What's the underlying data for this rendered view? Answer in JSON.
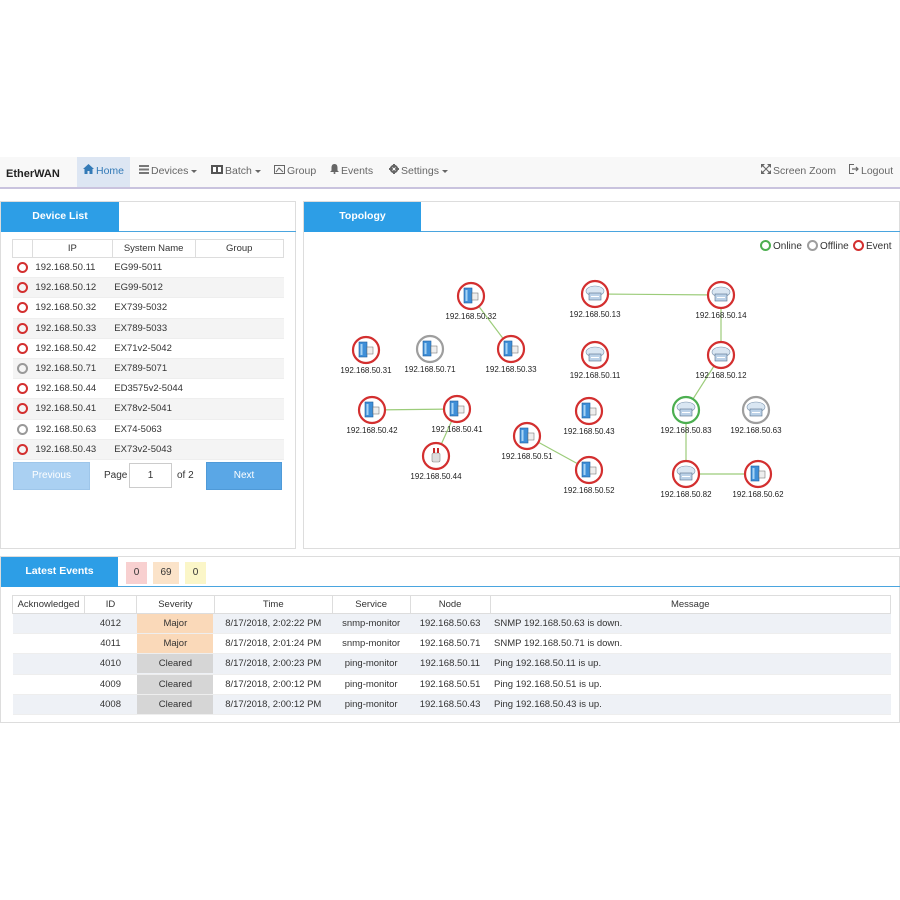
{
  "nav": {
    "brand": "EtherWAN",
    "items": [
      {
        "label": "Home",
        "icon": "home-icon"
      },
      {
        "label": "Devices",
        "icon": "list-icon"
      },
      {
        "label": "Batch",
        "icon": "batch-icon"
      },
      {
        "label": "Group",
        "icon": "group-icon"
      },
      {
        "label": "Events",
        "icon": "bell-icon"
      },
      {
        "label": "Settings",
        "icon": "gear-icon"
      }
    ],
    "right": [
      {
        "label": "Screen Zoom",
        "icon": "expand-icon"
      },
      {
        "label": "Logout",
        "icon": "logout-icon"
      }
    ]
  },
  "device_list": {
    "title": "Device List",
    "columns": [
      "IP",
      "System Name",
      "Group"
    ],
    "rows": [
      {
        "ip": "192.168.50.11",
        "name": "EG99-5011",
        "group": "",
        "status": "event"
      },
      {
        "ip": "192.168.50.12",
        "name": "EG99-5012",
        "group": "",
        "status": "event"
      },
      {
        "ip": "192.168.50.32",
        "name": "EX739-5032",
        "group": "",
        "status": "event"
      },
      {
        "ip": "192.168.50.33",
        "name": "EX789-5033",
        "group": "",
        "status": "event"
      },
      {
        "ip": "192.168.50.42",
        "name": "EX71v2-5042",
        "group": "",
        "status": "event"
      },
      {
        "ip": "192.168.50.71",
        "name": "EX789-5071",
        "group": "",
        "status": "offline"
      },
      {
        "ip": "192.168.50.44",
        "name": "ED3575v2-5044",
        "group": "",
        "status": "event"
      },
      {
        "ip": "192.168.50.41",
        "name": "EX78v2-5041",
        "group": "",
        "status": "event"
      },
      {
        "ip": "192.168.50.63",
        "name": "EX74-5063",
        "group": "",
        "status": "offline"
      },
      {
        "ip": "192.168.50.43",
        "name": "EX73v2-5043",
        "group": "",
        "status": "event"
      }
    ],
    "pager": {
      "previous": "Previous",
      "page_label": "Page",
      "page": "1",
      "of": "of 2",
      "next": "Next"
    }
  },
  "topology": {
    "title": "Topology",
    "legend": [
      {
        "label": "Online",
        "color": "#4caf50"
      },
      {
        "label": "Offline",
        "color": "#9e9e9e"
      },
      {
        "label": "Event",
        "color": "#d32f2f"
      }
    ],
    "nodes": [
      {
        "id": "192.168.50.32",
        "status": "event",
        "kind": "box",
        "badge": "L3"
      },
      {
        "id": "192.168.50.13",
        "status": "event",
        "kind": "cloud",
        "badge": "L2"
      },
      {
        "id": "192.168.50.14",
        "status": "event",
        "kind": "cloud",
        "badge": "L2"
      },
      {
        "id": "192.168.50.31",
        "status": "event",
        "kind": "box",
        "badge": "L2"
      },
      {
        "id": "192.168.50.71",
        "status": "offline",
        "kind": "box",
        "badge": "L3"
      },
      {
        "id": "192.168.50.33",
        "status": "event",
        "kind": "box",
        "badge": "L3"
      },
      {
        "id": "192.168.50.11",
        "status": "event",
        "kind": "cloud",
        "badge": "L2"
      },
      {
        "id": "192.168.50.12",
        "status": "event",
        "kind": "cloud",
        "badge": "L2"
      },
      {
        "id": "192.168.50.42",
        "status": "event",
        "kind": "box",
        "badge": "L2"
      },
      {
        "id": "192.168.50.41",
        "status": "event",
        "kind": "box",
        "badge": "L2"
      },
      {
        "id": "192.168.50.43",
        "status": "event",
        "kind": "box",
        "badge": "L2"
      },
      {
        "id": "192.168.50.83",
        "status": "online",
        "kind": "cloud",
        "badge": "L2"
      },
      {
        "id": "192.168.50.63",
        "status": "offline",
        "kind": "cloud",
        "badge": "L2"
      },
      {
        "id": "192.168.50.51",
        "status": "event",
        "kind": "box",
        "badge": "L2"
      },
      {
        "id": "192.168.50.44",
        "status": "event",
        "kind": "plug",
        "badge": ""
      },
      {
        "id": "192.168.50.52",
        "status": "event",
        "kind": "box",
        "badge": "L2"
      },
      {
        "id": "192.168.50.82",
        "status": "event",
        "kind": "cloud",
        "badge": "L2"
      },
      {
        "id": "192.168.50.62",
        "status": "event",
        "kind": "box",
        "badge": "L2"
      }
    ],
    "links": [
      [
        "192.168.50.32",
        "192.168.50.33"
      ],
      [
        "192.168.50.13",
        "192.168.50.14"
      ],
      [
        "192.168.50.14",
        "192.168.50.12"
      ],
      [
        "192.168.50.12",
        "192.168.50.83"
      ],
      [
        "192.168.50.42",
        "192.168.50.41"
      ],
      [
        "192.168.50.41",
        "192.168.50.44"
      ],
      [
        "192.168.50.51",
        "192.168.50.52"
      ],
      [
        "192.168.50.83",
        "192.168.50.82"
      ],
      [
        "192.168.50.82",
        "192.168.50.62"
      ]
    ]
  },
  "events": {
    "title": "Latest Events",
    "badges": [
      {
        "value": "0",
        "color": "#f8d0d0"
      },
      {
        "value": "69",
        "color": "#fbe3c9"
      },
      {
        "value": "0",
        "color": "#fbf6c8"
      }
    ],
    "columns": [
      "Acknowledged",
      "ID",
      "Severity",
      "Time",
      "Service",
      "Node",
      "Message"
    ],
    "rows": [
      {
        "ack": "",
        "id": "4012",
        "severity": "Major",
        "time": "8/17/2018, 2:02:22 PM",
        "service": "snmp-monitor",
        "node": "192.168.50.63",
        "message": "SNMP 192.168.50.63 is down."
      },
      {
        "ack": "",
        "id": "4011",
        "severity": "Major",
        "time": "8/17/2018, 2:01:24 PM",
        "service": "snmp-monitor",
        "node": "192.168.50.71",
        "message": "SNMP 192.168.50.71 is down."
      },
      {
        "ack": "",
        "id": "4010",
        "severity": "Cleared",
        "time": "8/17/2018, 2:00:23 PM",
        "service": "ping-monitor",
        "node": "192.168.50.11",
        "message": "Ping 192.168.50.11 is up."
      },
      {
        "ack": "",
        "id": "4009",
        "severity": "Cleared",
        "time": "8/17/2018, 2:00:12 PM",
        "service": "ping-monitor",
        "node": "192.168.50.51",
        "message": "Ping 192.168.50.51 is up."
      },
      {
        "ack": "",
        "id": "4008",
        "severity": "Cleared",
        "time": "8/17/2018, 2:00:12 PM",
        "service": "ping-monitor",
        "node": "192.168.50.43",
        "message": "Ping 192.168.50.43 is up."
      }
    ]
  }
}
